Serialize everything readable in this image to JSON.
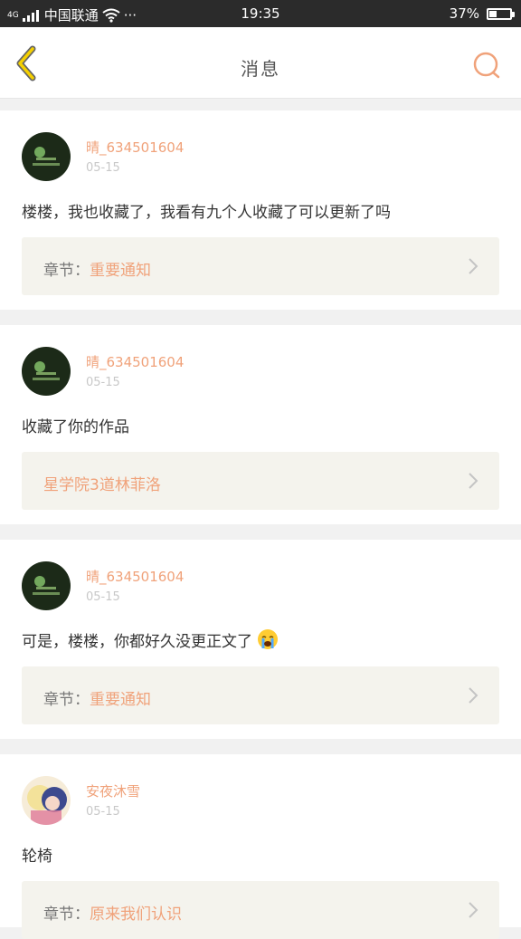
{
  "status_bar": {
    "network_type": "4G",
    "carrier": "中国联通",
    "menu_dots": "···",
    "time": "19:35",
    "battery_text": "37%",
    "battery_level": 0.37
  },
  "nav": {
    "title": "消息",
    "back_icon": "chevron-left-icon",
    "search_icon": "search-icon",
    "accent_color": "#f0a27a"
  },
  "messages": [
    {
      "username": "晴_634501604",
      "date": "05-15",
      "content": "楼楼，我也收藏了，我看有九个人收藏了可以更新了吗",
      "chapter_label": "章节：",
      "chapter_title": "重要通知"
    },
    {
      "username": "晴_634501604",
      "date": "05-15",
      "content": "收藏了你的作品",
      "chapter_label": "",
      "chapter_title": "星学院3道林菲洛"
    },
    {
      "username": "晴_634501604",
      "date": "05-15",
      "content": "可是，楼楼，你都好久没更正文了",
      "chapter_label": "章节：",
      "chapter_title": "重要通知"
    },
    {
      "username": "安夜沐雪",
      "date": "05-15",
      "content": "轮椅",
      "chapter_label": "章节：",
      "chapter_title": "原来我们认识"
    }
  ]
}
